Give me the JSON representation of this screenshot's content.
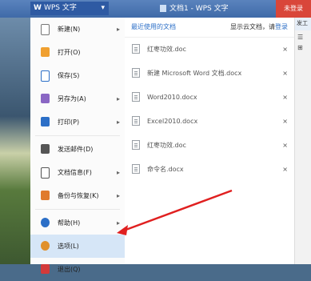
{
  "titlebar": {
    "app_menu_label": "WPS 文字",
    "app_logo": "W",
    "doc_title": "文档1 - WPS 文字",
    "login_tag": "未登录"
  },
  "menu": {
    "items": [
      {
        "label": "新建(N)",
        "icon": "new-doc-icon",
        "arrow": "▸"
      },
      {
        "label": "打开(O)",
        "icon": "open-folder-icon",
        "arrow": ""
      },
      {
        "label": "保存(S)",
        "icon": "save-icon",
        "arrow": ""
      },
      {
        "label": "另存为(A)",
        "icon": "save-as-icon",
        "arrow": "▸"
      },
      {
        "label": "打印(P)",
        "icon": "printer-icon",
        "arrow": "▸"
      },
      {
        "label": "发送邮件(D)",
        "icon": "mail-icon",
        "arrow": ""
      },
      {
        "label": "文档信息(F)",
        "icon": "info-icon",
        "arrow": "▸"
      },
      {
        "label": "备份与恢复(K)",
        "icon": "backup-icon",
        "arrow": "▸"
      },
      {
        "label": "帮助(H)",
        "icon": "help-icon",
        "arrow": "▸"
      },
      {
        "label": "选项(L)",
        "icon": "options-gear-icon",
        "arrow": ""
      },
      {
        "label": "退出(Q)",
        "icon": "exit-icon",
        "arrow": ""
      }
    ],
    "selected_index": 9
  },
  "recent": {
    "title": "最近使用的文档",
    "cloud_text": "显示云文档，请",
    "login_link": "登录",
    "close_glyph": "×",
    "docs": [
      {
        "name": "红枣功效.doc"
      },
      {
        "name": "新建 Microsoft Word 文档.docx"
      },
      {
        "name": "Word2010.docx"
      },
      {
        "name": "Excel2010.docx"
      },
      {
        "name": "红枣功效.doc"
      },
      {
        "name": "命令名.docx"
      }
    ]
  },
  "rightbar": {
    "tab": "发工",
    "glyph1": "☰",
    "glyph2": "⊞"
  },
  "colors": {
    "accent": "#2c6fc7",
    "selected_bg": "#d6e6f7",
    "login_tag_bg": "#d9463a",
    "arrow_red": "#e02020"
  }
}
